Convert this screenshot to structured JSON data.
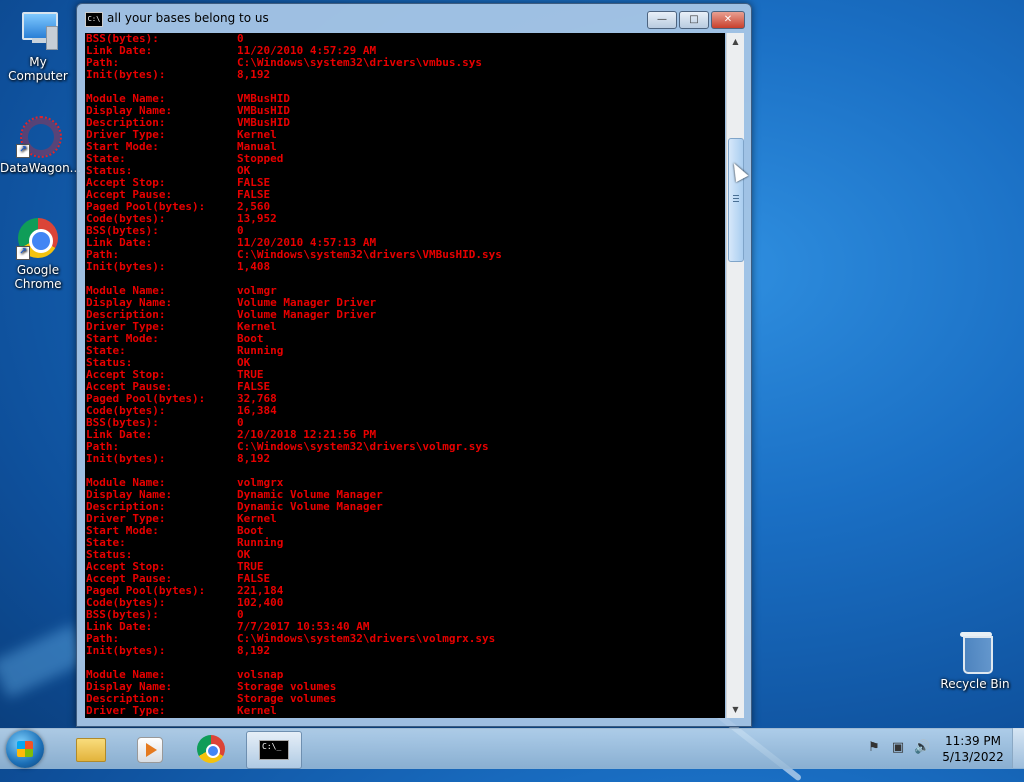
{
  "desktop": {
    "icons": [
      {
        "label": "My Computer"
      },
      {
        "label": "DataWagon..."
      },
      {
        "label": "Google Chrome"
      },
      {
        "label": "Recycle Bin"
      }
    ]
  },
  "window": {
    "title": "all your bases belong to us",
    "icon_text": "C:\\",
    "buttons": {
      "minimize": "—",
      "maximize": "□",
      "close": "✕"
    }
  },
  "console": {
    "lines": [
      {
        "label": "BSS(bytes):",
        "value": "0"
      },
      {
        "label": "Link Date:",
        "value": "11/20/2010 4:57:29 AM"
      },
      {
        "label": "Path:",
        "value": "C:\\Windows\\system32\\drivers\\vmbus.sys"
      },
      {
        "label": "Init(bytes):",
        "value": "8,192"
      },
      {
        "label": "",
        "value": ""
      },
      {
        "label": "Module Name:",
        "value": "VMBusHID"
      },
      {
        "label": "Display Name:",
        "value": "VMBusHID"
      },
      {
        "label": "Description:",
        "value": "VMBusHID"
      },
      {
        "label": "Driver Type:",
        "value": "Kernel"
      },
      {
        "label": "Start Mode:",
        "value": "Manual"
      },
      {
        "label": "State:",
        "value": "Stopped"
      },
      {
        "label": "Status:",
        "value": "OK"
      },
      {
        "label": "Accept Stop:",
        "value": "FALSE"
      },
      {
        "label": "Accept Pause:",
        "value": "FALSE"
      },
      {
        "label": "Paged Pool(bytes):",
        "value": "2,560"
      },
      {
        "label": "Code(bytes):",
        "value": "13,952"
      },
      {
        "label": "BSS(bytes):",
        "value": "0"
      },
      {
        "label": "Link Date:",
        "value": "11/20/2010 4:57:13 AM"
      },
      {
        "label": "Path:",
        "value": "C:\\Windows\\system32\\drivers\\VMBusHID.sys"
      },
      {
        "label": "Init(bytes):",
        "value": "1,408"
      },
      {
        "label": "",
        "value": ""
      },
      {
        "label": "Module Name:",
        "value": "volmgr"
      },
      {
        "label": "Display Name:",
        "value": "Volume Manager Driver"
      },
      {
        "label": "Description:",
        "value": "Volume Manager Driver"
      },
      {
        "label": "Driver Type:",
        "value": "Kernel"
      },
      {
        "label": "Start Mode:",
        "value": "Boot"
      },
      {
        "label": "State:",
        "value": "Running"
      },
      {
        "label": "Status:",
        "value": "OK"
      },
      {
        "label": "Accept Stop:",
        "value": "TRUE"
      },
      {
        "label": "Accept Pause:",
        "value": "FALSE"
      },
      {
        "label": "Paged Pool(bytes):",
        "value": "32,768"
      },
      {
        "label": "Code(bytes):",
        "value": "16,384"
      },
      {
        "label": "BSS(bytes):",
        "value": "0"
      },
      {
        "label": "Link Date:",
        "value": "2/10/2018 12:21:56 PM"
      },
      {
        "label": "Path:",
        "value": "C:\\Windows\\system32\\drivers\\volmgr.sys"
      },
      {
        "label": "Init(bytes):",
        "value": "8,192"
      },
      {
        "label": "",
        "value": ""
      },
      {
        "label": "Module Name:",
        "value": "volmgrx"
      },
      {
        "label": "Display Name:",
        "value": "Dynamic Volume Manager"
      },
      {
        "label": "Description:",
        "value": "Dynamic Volume Manager"
      },
      {
        "label": "Driver Type:",
        "value": "Kernel"
      },
      {
        "label": "Start Mode:",
        "value": "Boot"
      },
      {
        "label": "State:",
        "value": "Running"
      },
      {
        "label": "Status:",
        "value": "OK"
      },
      {
        "label": "Accept Stop:",
        "value": "TRUE"
      },
      {
        "label": "Accept Pause:",
        "value": "FALSE"
      },
      {
        "label": "Paged Pool(bytes):",
        "value": "221,184"
      },
      {
        "label": "Code(bytes):",
        "value": "102,400"
      },
      {
        "label": "BSS(bytes):",
        "value": "0"
      },
      {
        "label": "Link Date:",
        "value": "7/7/2017 10:53:40 AM"
      },
      {
        "label": "Path:",
        "value": "C:\\Windows\\system32\\drivers\\volmgrx.sys"
      },
      {
        "label": "Init(bytes):",
        "value": "8,192"
      },
      {
        "label": "",
        "value": ""
      },
      {
        "label": "Module Name:",
        "value": "volsnap"
      },
      {
        "label": "Display Name:",
        "value": "Storage volumes"
      },
      {
        "label": "Description:",
        "value": "Storage volumes"
      },
      {
        "label": "Driver Type:",
        "value": "Kernel"
      }
    ],
    "text_color": "#e80000",
    "background_color": "#000000"
  },
  "scrollbar": {
    "up_arrow": "▲",
    "down_arrow": "▼"
  },
  "taskbar": {
    "items": [
      {
        "icon": "windows-explorer-icon"
      },
      {
        "icon": "media-player-icon"
      },
      {
        "icon": "chrome-icon"
      },
      {
        "icon": "command-prompt-icon",
        "text": "C:\\_"
      }
    ],
    "tray": {
      "action_center": "⚑",
      "network": "▣",
      "volume": "🔊"
    },
    "clock": {
      "time": "11:39 PM",
      "date": "5/13/2022"
    }
  }
}
